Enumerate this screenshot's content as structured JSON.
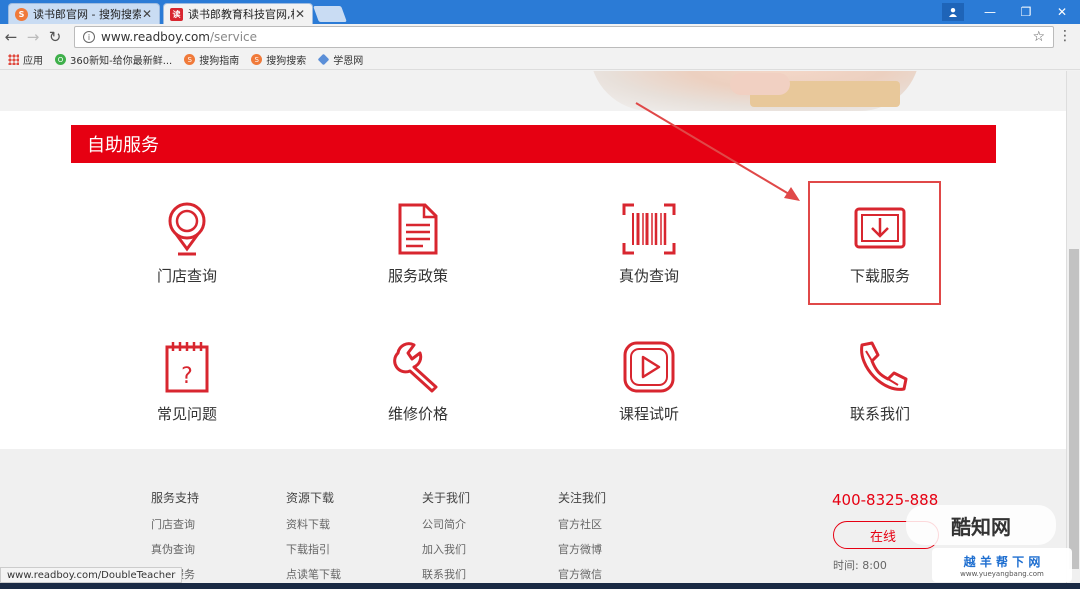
{
  "browser": {
    "tabs": [
      {
        "title": "读书郎官网 - 搜狗搜索",
        "favicon": "sogou-icon",
        "active": false
      },
      {
        "title": "读书郎教育科技官网,相信...",
        "favicon": "readboy-icon",
        "favicon_text": "读",
        "active": true
      }
    ],
    "url_host": "www.readboy.com",
    "url_path": "/service",
    "bookmarks": [
      {
        "label": "应用",
        "icon": "apps-icon"
      },
      {
        "label": "360新知-给你最新鲜...",
        "icon": "360-icon"
      },
      {
        "label": "搜狗指南",
        "icon": "sogou-icon"
      },
      {
        "label": "搜狗搜索",
        "icon": "sogou-icon"
      },
      {
        "label": "学恩网",
        "icon": "diamond-icon"
      }
    ],
    "status_url": "www.readboy.com/DoubleTeacher"
  },
  "page": {
    "section_title": "自助服务",
    "services": [
      {
        "label": "门店查询",
        "icon": "location-pin-icon"
      },
      {
        "label": "服务政策",
        "icon": "document-icon"
      },
      {
        "label": "真伪查询",
        "icon": "barcode-scan-icon"
      },
      {
        "label": "下载服务",
        "icon": "download-icon"
      },
      {
        "label": "常见问题",
        "icon": "calendar-question-icon"
      },
      {
        "label": "维修价格",
        "icon": "wrench-icon"
      },
      {
        "label": "课程试听",
        "icon": "play-video-icon"
      },
      {
        "label": "联系我们",
        "icon": "phone-icon"
      }
    ],
    "footer": {
      "columns": [
        {
          "heading": "服务支持",
          "items": [
            "门店查询",
            "真伪查询",
            "保修服务"
          ]
        },
        {
          "heading": "资源下载",
          "items": [
            "资料下载",
            "下载指引",
            "点读笔下载"
          ]
        },
        {
          "heading": "关于我们",
          "items": [
            "公司简介",
            "加入我们",
            "联系我们"
          ]
        },
        {
          "heading": "关注我们",
          "items": [
            "官方社区",
            "官方微博",
            "官方微信"
          ]
        }
      ],
      "hotline": "400-8325-888",
      "online_button": "在线",
      "work_time": "时间: 8:00"
    }
  },
  "watermarks": {
    "top": "酷知网",
    "bottom_title": "越 羊 帮 下 网",
    "bottom_url": "www.yueyangbang.com"
  },
  "colors": {
    "brand_red": "#e60012",
    "highlight_red": "#e04848",
    "tabstrip_blue": "#2b7bd6"
  }
}
